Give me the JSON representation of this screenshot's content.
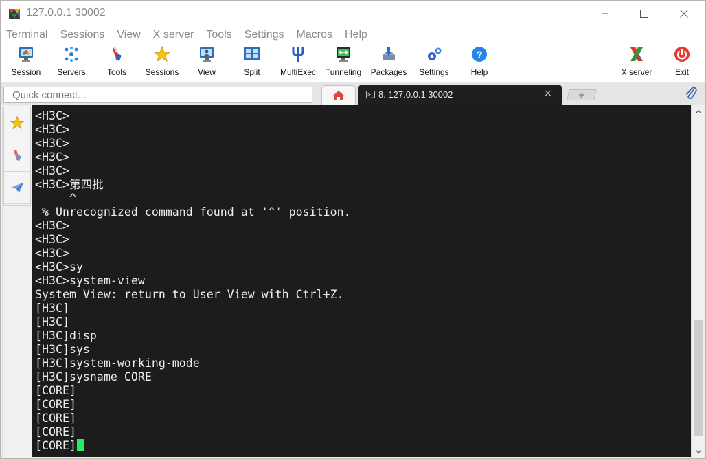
{
  "window": {
    "title": "127.0.0.1 30002"
  },
  "menu": [
    "Terminal",
    "Sessions",
    "View",
    "X server",
    "Tools",
    "Settings",
    "Macros",
    "Help"
  ],
  "toolbar": {
    "session": "Session",
    "servers": "Servers",
    "tools": "Tools",
    "sessions": "Sessions",
    "view": "View",
    "split": "Split",
    "multiexec": "MultiExec",
    "tunneling": "Tunneling",
    "packages": "Packages",
    "settings": "Settings",
    "help": "Help",
    "xserver": "X server",
    "exit": "Exit"
  },
  "quick_connect": {
    "placeholder": "Quick connect..."
  },
  "tabs": {
    "active_label": "8. 127.0.0.1 30002",
    "close_glyph": "×",
    "terminal_glyph": ">_"
  },
  "terminal": {
    "lines": [
      "<H3C>",
      "<H3C>",
      "<H3C>",
      "<H3C>",
      "<H3C>",
      "<H3C>第四批",
      "     ^",
      " % Unrecognized command found at '^' position.",
      "<H3C>",
      "<H3C>",
      "<H3C>",
      "<H3C>sy",
      "<H3C>system-view",
      "System View: return to User View with Ctrl+Z.",
      "[H3C]",
      "[H3C]",
      "[H3C]disp",
      "[H3C]sys",
      "[H3C]system-working-mode",
      "[H3C]sysname CORE",
      "[CORE]",
      "[CORE]",
      "[CORE]",
      "[CORE]",
      "[CORE]"
    ],
    "cursor_color": "#22ee66"
  },
  "colors": {
    "terminal_bg": "#1c1c1c",
    "terminal_fg": "#ededed"
  }
}
